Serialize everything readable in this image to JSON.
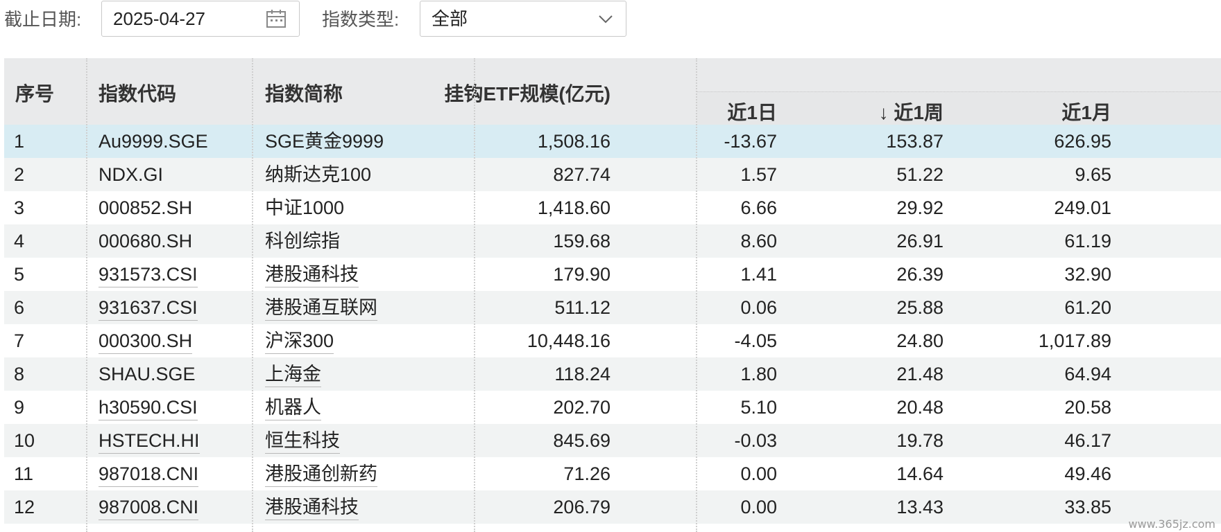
{
  "filters": {
    "date_label": "截止日期:",
    "date_value": "2025-04-27",
    "type_label": "指数类型:",
    "type_value": "全部"
  },
  "table": {
    "headers": {
      "seq": "序号",
      "code": "指数代码",
      "name": "指数简称",
      "etf": "挂钩ETF规模(亿元)",
      "d1": "近1日",
      "w1": "↓ 近1周",
      "m1": "近1月"
    },
    "rows": [
      {
        "seq": "1",
        "code": "Au9999.SGE",
        "name": "SGE黄金9999",
        "etf": "1,508.16",
        "d1": "-13.67",
        "w1": "153.87",
        "m1": "626.95",
        "code_link": false,
        "name_link": false
      },
      {
        "seq": "2",
        "code": "NDX.GI",
        "name": "纳斯达克100",
        "etf": "827.74",
        "d1": "1.57",
        "w1": "51.22",
        "m1": "9.65",
        "code_link": false,
        "name_link": false
      },
      {
        "seq": "3",
        "code": "000852.SH",
        "name": "中证1000",
        "etf": "1,418.60",
        "d1": "6.66",
        "w1": "29.92",
        "m1": "249.01",
        "code_link": false,
        "name_link": false
      },
      {
        "seq": "4",
        "code": "000680.SH",
        "name": "科创综指",
        "etf": "159.68",
        "d1": "8.60",
        "w1": "26.91",
        "m1": "61.19",
        "code_link": false,
        "name_link": false
      },
      {
        "seq": "5",
        "code": "931573.CSI",
        "name": "港股通科技",
        "etf": "179.90",
        "d1": "1.41",
        "w1": "26.39",
        "m1": "32.90",
        "code_link": true,
        "name_link": true
      },
      {
        "seq": "6",
        "code": "931637.CSI",
        "name": "港股通互联网",
        "etf": "511.12",
        "d1": "0.06",
        "w1": "25.88",
        "m1": "61.20",
        "code_link": true,
        "name_link": true
      },
      {
        "seq": "7",
        "code": "000300.SH",
        "name": "沪深300",
        "etf": "10,448.16",
        "d1": "-4.05",
        "w1": "24.80",
        "m1": "1,017.89",
        "code_link": true,
        "name_link": true
      },
      {
        "seq": "8",
        "code": "SHAU.SGE",
        "name": "上海金",
        "etf": "118.24",
        "d1": "1.80",
        "w1": "21.48",
        "m1": "64.94",
        "code_link": false,
        "name_link": true
      },
      {
        "seq": "9",
        "code": "h30590.CSI",
        "name": "机器人",
        "etf": "202.70",
        "d1": "5.10",
        "w1": "20.48",
        "m1": "20.58",
        "code_link": true,
        "name_link": true
      },
      {
        "seq": "10",
        "code": "HSTECH.HI",
        "name": "恒生科技",
        "etf": "845.69",
        "d1": "-0.03",
        "w1": "19.78",
        "m1": "46.17",
        "code_link": true,
        "name_link": true
      },
      {
        "seq": "11",
        "code": "987018.CNI",
        "name": "港股通创新药",
        "etf": "71.26",
        "d1": "0.00",
        "w1": "14.64",
        "m1": "49.46",
        "code_link": true,
        "name_link": true
      },
      {
        "seq": "12",
        "code": "987008.CNI",
        "name": "港股通科技",
        "etf": "206.79",
        "d1": "0.00",
        "w1": "13.43",
        "m1": "33.85",
        "code_link": true,
        "name_link": true
      }
    ]
  },
  "watermark": "www.365jz.com"
}
